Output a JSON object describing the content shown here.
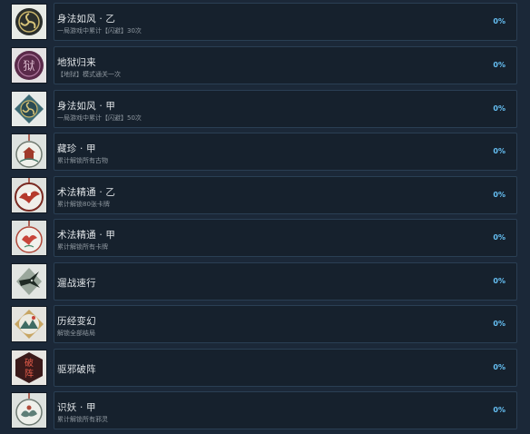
{
  "achievements": [
    {
      "icon": "triskelion-medallion-dark-icon",
      "title": "身法如风 · 乙",
      "desc": "一局游戏中累计【闪避】30次",
      "percent": "0%"
    },
    {
      "icon": "hell-seal-icon",
      "title": "地狱归来",
      "desc": "【地狱】模式通关一次",
      "percent": "0%"
    },
    {
      "icon": "triskelion-medallion-teal-icon",
      "title": "身法如风 · 甲",
      "desc": "一局游戏中累计【闪避】50次",
      "percent": "0%"
    },
    {
      "icon": "pagoda-pendant-icon",
      "title": "藏珍 · 甲",
      "desc": "累计解锁所有古物",
      "percent": "0%"
    },
    {
      "icon": "crane-pendant-icon",
      "title": "术法精通 · 乙",
      "desc": "累计解锁80张卡牌",
      "percent": "0%"
    },
    {
      "icon": "crane-pendant-red-icon",
      "title": "术法精通 · 甲",
      "desc": "累计解锁所有卡牌",
      "percent": "0%"
    },
    {
      "icon": "swallow-badge-icon",
      "title": "遛战速行",
      "desc": "",
      "percent": "0%"
    },
    {
      "icon": "landscape-badge-icon",
      "title": "历经变幻",
      "desc": "解锁全部结局",
      "percent": "0%"
    },
    {
      "icon": "break-formation-seal-icon",
      "title": "驱邪破阵",
      "desc": "",
      "percent": "0%"
    },
    {
      "icon": "demon-pendant-icon",
      "title": "识妖 · 甲",
      "desc": "累计解锁所有邪灵",
      "percent": "0%"
    }
  ]
}
